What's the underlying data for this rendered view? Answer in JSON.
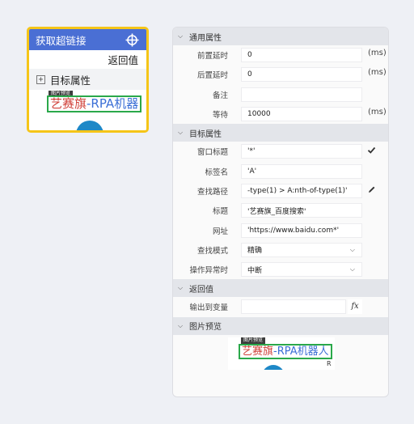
{
  "card": {
    "title": "获取超链接",
    "return_label": "返回值",
    "target_label": "目标属性",
    "expand_symbol": "+",
    "thumb_tag": "图片预览",
    "thumb_text_red": "艺赛旗",
    "thumb_text_blue": "-RPA机器"
  },
  "panel": {
    "sections": {
      "general": "通用属性",
      "target": "目标属性",
      "return": "返回值",
      "preview": "图片预览"
    },
    "general": {
      "pre_delay_label": "前置延时",
      "pre_delay_value": "0",
      "pre_delay_unit": "(ms)",
      "post_delay_label": "后置延时",
      "post_delay_value": "0",
      "post_delay_unit": "(ms)",
      "note_label": "备注",
      "note_value": "",
      "wait_label": "等待",
      "wait_value": "10000",
      "wait_unit": "(ms)"
    },
    "target": {
      "window_title_label": "窗口标题",
      "window_title_value": "'*'",
      "tag_name_label": "标签名",
      "tag_name_value": "'A'",
      "find_path_label": "查找路径",
      "find_path_value": "-type(1) > A:nth-of-type(1)'",
      "title_label": "标题",
      "title_value": "'艺赛旗_百度搜索'",
      "url_label": "网址",
      "url_value": "'https://www.baidu.com*'",
      "find_mode_label": "查找模式",
      "find_mode_value": "精确",
      "on_error_label": "操作异常时",
      "on_error_value": "中断"
    },
    "return": {
      "output_label": "输出到变量",
      "output_value": "",
      "fx_symbol": "fx"
    },
    "preview": {
      "tag": "图片预览",
      "text_red": "艺赛旗",
      "text_blue": "-RPA机器人",
      "side_char": "R"
    }
  },
  "icons": {
    "chevron": "chevron-down-icon",
    "check": "check-icon",
    "pencil": "pencil-icon",
    "crosshair": "crosshair-icon"
  },
  "colors": {
    "card_header": "#4a6fd4",
    "card_border": "#f5c518",
    "section_bg": "#e3e5ea"
  }
}
